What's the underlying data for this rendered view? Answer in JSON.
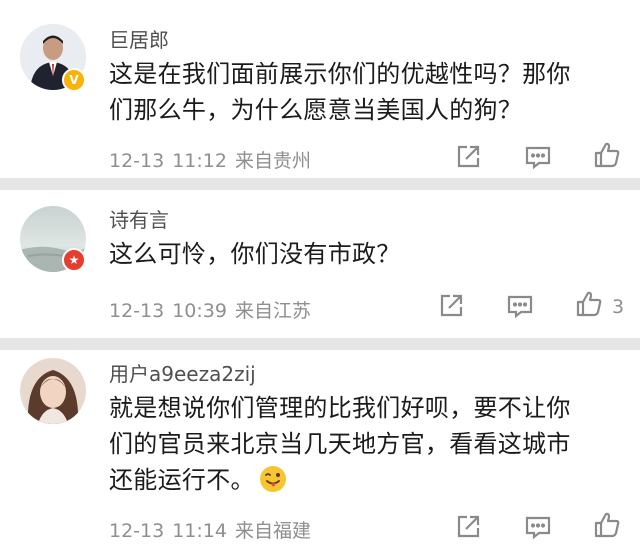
{
  "comments": [
    {
      "username": "巨居郎",
      "text_lines": [
        "这是在我们面前展示你们的优越性吗？那你",
        "们那么牛，为什么愿意当美国人的狗？"
      ],
      "date": "12-13",
      "time": "11:12",
      "location": "来自贵州",
      "likes": "",
      "badge": "V"
    },
    {
      "username": "诗有言",
      "text_lines": [
        "这么可怜，你们没有市政？"
      ],
      "date": "12-13",
      "time": "10:39",
      "location": "来自江苏",
      "likes": "3",
      "badge": "★"
    },
    {
      "username": "用户a9eeza2zij",
      "text_lines": [
        "就是想说你们管理的比我们好呗，要不让你",
        "们的官员来北京当几天地方官，看看这城市",
        "还能运行不。"
      ],
      "date": "12-13",
      "time": "11:14",
      "location": "来自福建",
      "likes": "",
      "badge": ""
    }
  ],
  "icons": {
    "share": "share-icon",
    "reply": "comment-icon",
    "like": "thumbs-up-icon",
    "emoji": "tongue-wink-emoji"
  },
  "colors": {
    "meta": "#8f8f8f",
    "divider": "#e6e6e6",
    "verified": "#f6b40a",
    "star_badge": "#e53d2f"
  }
}
